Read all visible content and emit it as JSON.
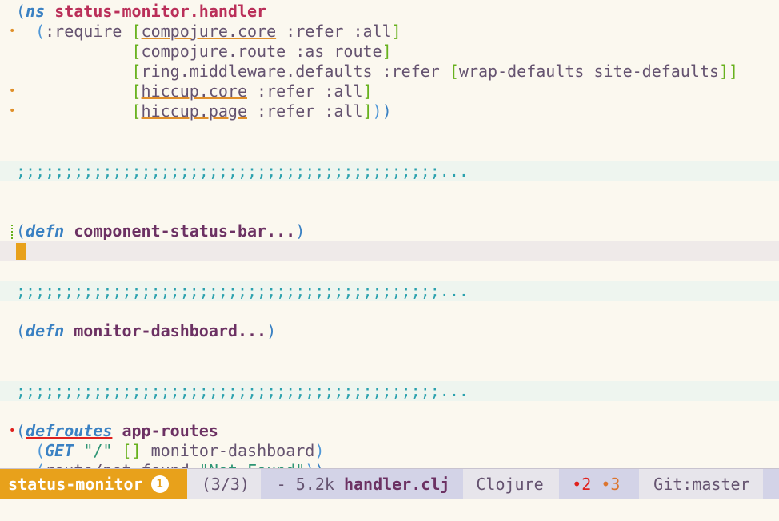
{
  "editor": {
    "ns_open": "(",
    "ns_kw": "ns",
    "ns_name": "status-monitor.handler",
    "require_open": "(",
    "require_kw": ":require",
    "req1_lib": "compojure.core",
    "req1_rest": " :refer :all",
    "req2_lib": "compojure.route",
    "req2_as": " :as route",
    "req3_lib": "ring.middleware.defaults",
    "req3_refer": " :refer ",
    "req3_vec": "wrap-defaults site-defaults",
    "req4_lib": "hiccup.core",
    "req4_rest": " :refer :all",
    "req5_lib": "hiccup.page",
    "req5_rest": " :refer :all",
    "fold_text": ";;;;;;;;;;;;;;;;;;;;;;;;;;;;;;;;;;;;;;;;;;;;...",
    "defn_kw": "defn",
    "fn1_name": "component-status-bar...",
    "fn2_name": "monitor-dashboard...",
    "defroutes_kw": "defroutes",
    "routes_name": "app-routes",
    "get_kw": "GET",
    "get_path": "\"/\"",
    "get_args": "[]",
    "get_handler": "monitor-dashboard",
    "notfound_call": "route/not-found",
    "notfound_str": "\"Not Found\""
  },
  "modeline": {
    "project": "status-monitor",
    "window_number": "1",
    "position": "(3/3)",
    "file_size": "- 5.2k",
    "file_name": "handler.clj",
    "mode": "Clojure",
    "errors": "•2",
    "warnings": "•3",
    "vcs": "Git:master"
  },
  "colors": {
    "background": "#fbf8ef",
    "accent": "#e8a11b",
    "keyword": "#3a81c3",
    "namespace": "#ba2f59"
  }
}
